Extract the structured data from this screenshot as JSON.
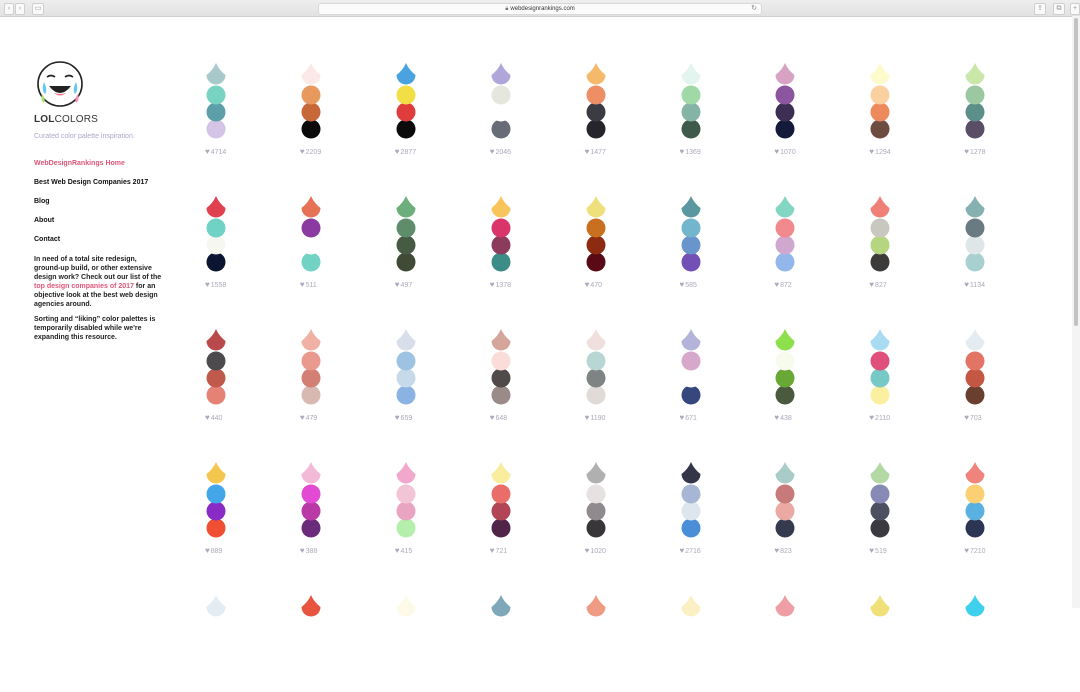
{
  "browser": {
    "url": "webdesignrankings.com"
  },
  "brand": {
    "name_bold": "LOL",
    "name_rest": "COLORS",
    "tagline": "Curated color palette inspiration."
  },
  "nav": {
    "home": "WebDesignRankings Home",
    "best": "Best Web Design Companies 2017",
    "blog": "Blog",
    "about": "About",
    "contact": "Contact"
  },
  "promo": {
    "text_before": "In need of a total site redesign, ground-up build, or other extensive design work? Check out our list of the ",
    "link": "top design companies of 2017",
    "text_after": " for an objective look at the best web design agencies around."
  },
  "notice": "Sorting and “liking” color palettes is temporarily disabled while we're expanding this resource.",
  "palettes": [
    [
      {
        "colors": [
          "#a8c9c9",
          "#78d3c3",
          "#5d9fa8",
          "#d4c4e6"
        ],
        "likes": "4714"
      },
      {
        "colors": [
          "#fbe9e6",
          "#e89a5e",
          "#c8683a",
          "#0b0b0b"
        ],
        "likes": "2209"
      },
      {
        "colors": [
          "#4aa3de",
          "#f1df45",
          "#df3c3c",
          "#0b0b0b"
        ],
        "likes": "2877"
      },
      {
        "colors": [
          "#b1a6da",
          "#e5e6de",
          "#ffffff",
          "#676c76"
        ],
        "likes": "2046"
      },
      {
        "colors": [
          "#f4b96a",
          "#ee8e66",
          "#3b3b43",
          "#25252b"
        ],
        "likes": "1477"
      },
      {
        "colors": [
          "#e4f5ef",
          "#9fdaa6",
          "#85b3a5",
          "#3f5a4a"
        ],
        "likes": "1369"
      },
      {
        "colors": [
          "#d8a2c4",
          "#8b55a0",
          "#3d2f53",
          "#131a3a"
        ],
        "likes": "1070"
      },
      {
        "colors": [
          "#fdfbcc",
          "#fbd0a1",
          "#ec8a5e",
          "#6e4c42"
        ],
        "likes": "1294"
      },
      {
        "colors": [
          "#c8e7a8",
          "#9bc8a0",
          "#5d8f8a",
          "#5a4d66"
        ],
        "likes": "1278"
      }
    ],
    [
      {
        "colors": [
          "#e0414f",
          "#6fd2c4",
          "#f6f8f0",
          "#0b1431"
        ],
        "likes": "1558"
      },
      {
        "colors": [
          "#e57254",
          "#8a3aa0",
          "#ffffff",
          "#72d2c3"
        ],
        "likes": "511"
      },
      {
        "colors": [
          "#6cae7c",
          "#5f8d6c",
          "#465a44",
          "#3f4b37"
        ],
        "likes": "497"
      },
      {
        "colors": [
          "#f8c55c",
          "#d9356a",
          "#8c3b5c",
          "#3c8c88"
        ],
        "likes": "1378"
      },
      {
        "colors": [
          "#eee07a",
          "#c8701f",
          "#8c2b12",
          "#5a0a14"
        ],
        "likes": "470"
      },
      {
        "colors": [
          "#5a97a1",
          "#73b5cc",
          "#6895cc",
          "#7350b6"
        ],
        "likes": "585"
      },
      {
        "colors": [
          "#83d7c2",
          "#f08a8e",
          "#cfa7cf",
          "#93b7ea"
        ],
        "likes": "872"
      },
      {
        "colors": [
          "#f07f78",
          "#c8c8c0",
          "#b5d580",
          "#3d3a3a"
        ],
        "likes": "827"
      },
      {
        "colors": [
          "#86b0b2",
          "#6a7a82",
          "#dfe6e8",
          "#a8d0d0"
        ],
        "likes": "1134"
      }
    ],
    [
      {
        "colors": [
          "#b84a4c",
          "#4d4a4e",
          "#c05a4c",
          "#e48276"
        ],
        "likes": "440"
      },
      {
        "colors": [
          "#f0b0a3",
          "#e9998e",
          "#d47f73",
          "#d8b9b1"
        ],
        "likes": "479"
      },
      {
        "colors": [
          "#d9dfea",
          "#9dc2e2",
          "#c7daea",
          "#8ab2e2"
        ],
        "likes": "659"
      },
      {
        "colors": [
          "#d4a69b",
          "#fadcd8",
          "#504a4a",
          "#9a8a88"
        ],
        "likes": "648"
      },
      {
        "colors": [
          "#efe0de",
          "#b7d6d4",
          "#7e8384",
          "#e0dbd6"
        ],
        "likes": "1190"
      },
      {
        "colors": [
          "#b4b3da",
          "#d6a8cc",
          "#ffffff",
          "#35477c"
        ],
        "likes": "671"
      },
      {
        "colors": [
          "#8de04c",
          "#f7fbee",
          "#6aa836",
          "#4a5a3e"
        ],
        "likes": "438"
      },
      {
        "colors": [
          "#a9dcf3",
          "#e0507c",
          "#76c9c4",
          "#fbf0a0"
        ],
        "likes": "2110"
      },
      {
        "colors": [
          "#e4ecf1",
          "#e27466",
          "#c45644",
          "#6a3f30"
        ],
        "likes": "703"
      }
    ],
    [
      {
        "colors": [
          "#f4c64e",
          "#43a6e8",
          "#8a2bc8",
          "#ef5033"
        ],
        "likes": "889"
      },
      {
        "colors": [
          "#f3bad8",
          "#e24ad4",
          "#b93aa6",
          "#6a2c7a"
        ],
        "likes": "388"
      },
      {
        "colors": [
          "#f2a8cc",
          "#f3c4d6",
          "#e9a4c1",
          "#b4f0ac"
        ],
        "likes": "415"
      },
      {
        "colors": [
          "#f8ee9e",
          "#e96e6a",
          "#b14556",
          "#51254a"
        ],
        "likes": "721"
      },
      {
        "colors": [
          "#b0b0b0",
          "#e6e2e2",
          "#8e8a8e",
          "#383638"
        ],
        "likes": "1020"
      },
      {
        "colors": [
          "#35354a",
          "#a8b6d6",
          "#dde5ee",
          "#4a8ed8"
        ],
        "likes": "2716"
      },
      {
        "colors": [
          "#a9ccc9",
          "#c87a7a",
          "#eaa9a3",
          "#363a4e"
        ],
        "likes": "823"
      },
      {
        "colors": [
          "#b3d8a3",
          "#878ab4",
          "#4c5060",
          "#3a3a40"
        ],
        "likes": "519"
      },
      {
        "colors": [
          "#f0837c",
          "#fbd072",
          "#5ab0e0",
          "#2d3554"
        ],
        "likes": "7210"
      }
    ],
    [
      {
        "colors": [
          "#e3ebf3"
        ]
      },
      {
        "colors": [
          "#e8553f"
        ]
      },
      {
        "colors": [
          "#fdfbe8"
        ]
      },
      {
        "colors": [
          "#7ea7b9"
        ]
      },
      {
        "colors": [
          "#ef9b83"
        ]
      },
      {
        "colors": [
          "#fbf0c4"
        ]
      },
      {
        "colors": [
          "#ef9ea6"
        ]
      },
      {
        "colors": [
          "#f0e07a"
        ]
      },
      {
        "colors": [
          "#3fd0ee"
        ]
      }
    ]
  ]
}
